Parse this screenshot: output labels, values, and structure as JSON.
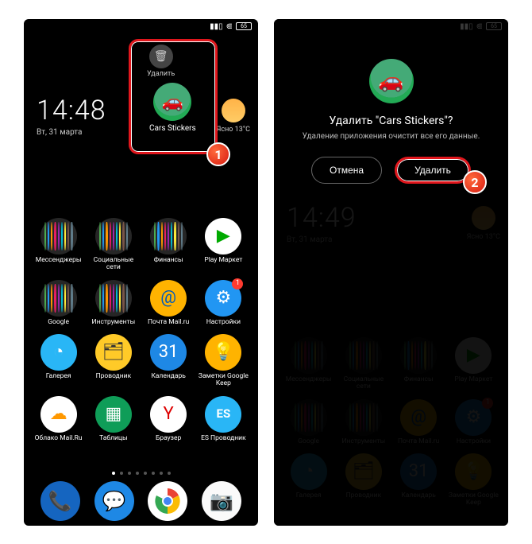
{
  "left": {
    "battery": "65",
    "delete_label": "Удалить",
    "dragged_app": "Cars Stickers",
    "time": "14:48",
    "date": "Вт, 31 марта",
    "weather_cond": "Ясно",
    "weather_temp": "13°C",
    "apps": [
      {
        "label": "Мессенджеры",
        "type": "folder"
      },
      {
        "label": "Социальные сети",
        "type": "folder"
      },
      {
        "label": "Финансы",
        "type": "folder"
      },
      {
        "label": "Play Маркет",
        "bg": "#fff",
        "glyph": "▶",
        "fg": "#0a0"
      },
      {
        "label": "Google",
        "type": "folder"
      },
      {
        "label": "Инструменты",
        "type": "folder"
      },
      {
        "label": "Почта Mail.ru",
        "bg": "#ffb300",
        "glyph": "@",
        "fg": "#005bbb"
      },
      {
        "label": "Настройки",
        "bg": "#2196f3",
        "glyph": "⚙",
        "fg": "#fff",
        "badge": "1"
      },
      {
        "label": "Галерея",
        "bg": "#29b6f6",
        "glyph": "◔",
        "fg": "#fff"
      },
      {
        "label": "Проводник",
        "bg": "#ffca28",
        "glyph": "🗂",
        "fg": "#333"
      },
      {
        "label": "Календарь",
        "bg": "#1e88e5",
        "glyph": "31",
        "fg": "#fff"
      },
      {
        "label": "Заметки Google Keep",
        "bg": "#ffb300",
        "glyph": "💡",
        "fg": "#fff"
      },
      {
        "label": "Облако Mail.Ru",
        "bg": "#fff",
        "glyph": "☁",
        "fg": "#ff9800"
      },
      {
        "label": "Таблицы",
        "bg": "#0f9d58",
        "glyph": "▦",
        "fg": "#fff"
      },
      {
        "label": "Браузер",
        "bg": "#fff",
        "glyph": "Y",
        "fg": "#d00"
      },
      {
        "label": "ES Проводник",
        "bg": "#29b6f6",
        "glyph": "ES",
        "fg": "#fff"
      }
    ],
    "step": "1"
  },
  "right": {
    "battery": "65",
    "dialog_title": "Удалить \"Cars Stickers\"?",
    "dialog_sub": "Удаление приложения очистит все его данные.",
    "btn_cancel": "Отмена",
    "btn_confirm": "Удалить",
    "time": "14:49",
    "date": "Вт, 31 марта",
    "weather_cond": "Ясно",
    "weather_temp": "13°C",
    "apps_row1": [
      "Мессенджеры",
      "Социальные сети",
      "Финансы",
      "Play Маркет"
    ],
    "apps_row2": [
      "Google",
      "Инструменты",
      "Почта Mail.ru",
      "Настройки"
    ],
    "apps_row3": [
      "Галерея",
      "Проводник",
      "Календарь",
      "Заметки"
    ],
    "step": "2"
  },
  "folder_colors": [
    "#4caf50",
    "#2196f3",
    "#ff9800",
    "#e91e63",
    "#9c27b0",
    "#00bcd4",
    "#ffeb3b",
    "#795548",
    "#607d8b"
  ]
}
